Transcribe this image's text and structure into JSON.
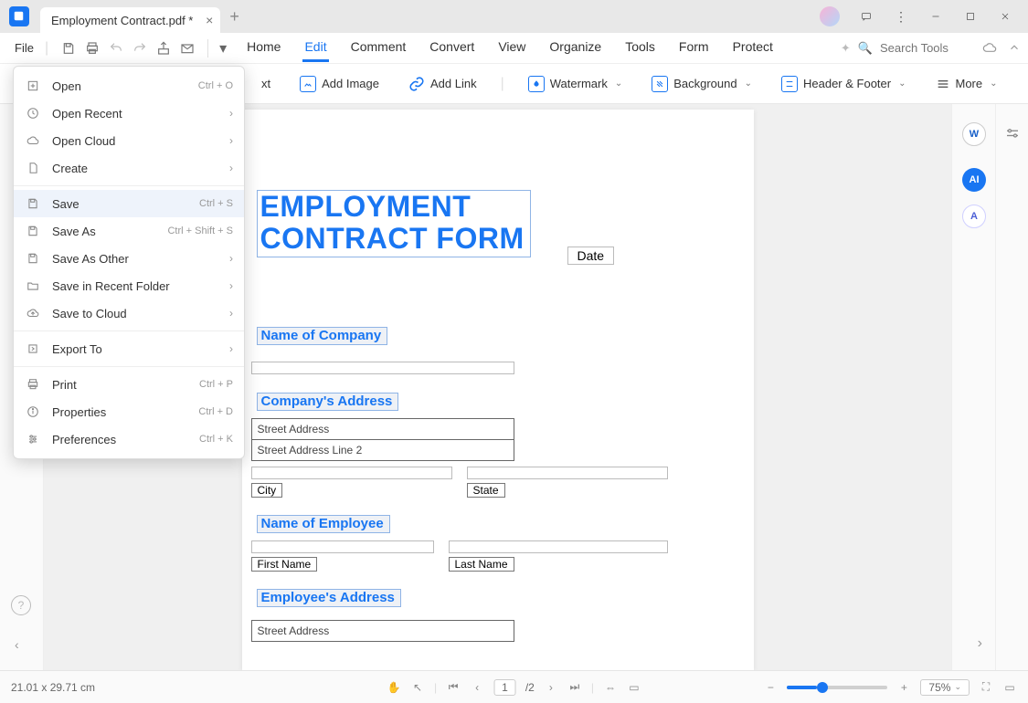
{
  "titlebar": {
    "tab_title": "Employment Contract.pdf *"
  },
  "menubar": {
    "file_label": "File",
    "tabs": [
      "Home",
      "Edit",
      "Comment",
      "Convert",
      "View",
      "Organize",
      "Tools",
      "Form",
      "Protect"
    ],
    "active_tab_index": 1,
    "search_placeholder": "Search Tools"
  },
  "toolbar": {
    "text_partial": "xt",
    "add_image": "Add Image",
    "add_link": "Add Link",
    "watermark": "Watermark",
    "background": "Background",
    "header_footer": "Header & Footer",
    "more": "More"
  },
  "file_menu": {
    "items": [
      {
        "label": "Open",
        "shortcut": "Ctrl + O",
        "icon": "plus",
        "sub": false
      },
      {
        "label": "Open Recent",
        "shortcut": "",
        "icon": "clock",
        "sub": true
      },
      {
        "label": "Open Cloud",
        "shortcut": "",
        "icon": "cloud",
        "sub": true
      },
      {
        "label": "Create",
        "shortcut": "",
        "icon": "doc",
        "sub": true
      },
      {
        "sep": true
      },
      {
        "label": "Save",
        "shortcut": "Ctrl + S",
        "icon": "save",
        "sub": false,
        "hover": true
      },
      {
        "label": "Save As",
        "shortcut": "Ctrl + Shift + S",
        "icon": "save",
        "sub": false
      },
      {
        "label": "Save As Other",
        "shortcut": "",
        "icon": "save",
        "sub": true
      },
      {
        "label": "Save in Recent Folder",
        "shortcut": "",
        "icon": "folder",
        "sub": true
      },
      {
        "label": "Save to Cloud",
        "shortcut": "",
        "icon": "cloud-up",
        "sub": true
      },
      {
        "sep": true
      },
      {
        "label": "Export To",
        "shortcut": "",
        "icon": "export",
        "sub": true
      },
      {
        "sep": true
      },
      {
        "label": "Print",
        "shortcut": "Ctrl + P",
        "icon": "print",
        "sub": false
      },
      {
        "label": "Properties",
        "shortcut": "Ctrl + D",
        "icon": "info",
        "sub": false
      },
      {
        "label": "Preferences",
        "shortcut": "Ctrl + K",
        "icon": "pref",
        "sub": false
      }
    ]
  },
  "document": {
    "title_line1": "EMPLOYMENT",
    "title_line2": "CONTRACT FORM",
    "date_label": "Date",
    "sec_name_company": "Name of Company",
    "sec_company_address": "Company's Address",
    "street_address": "Street Address",
    "street_address2": "Street Address Line 2",
    "city": "City",
    "state": "State",
    "sec_name_employee": "Name of Employee",
    "first_name": "First Name",
    "last_name": "Last Name",
    "sec_employee_address": "Employee's Address"
  },
  "status": {
    "dimensions": "21.01 x 29.71 cm",
    "page_current": "1",
    "page_total": "/2",
    "zoom": "75%"
  }
}
